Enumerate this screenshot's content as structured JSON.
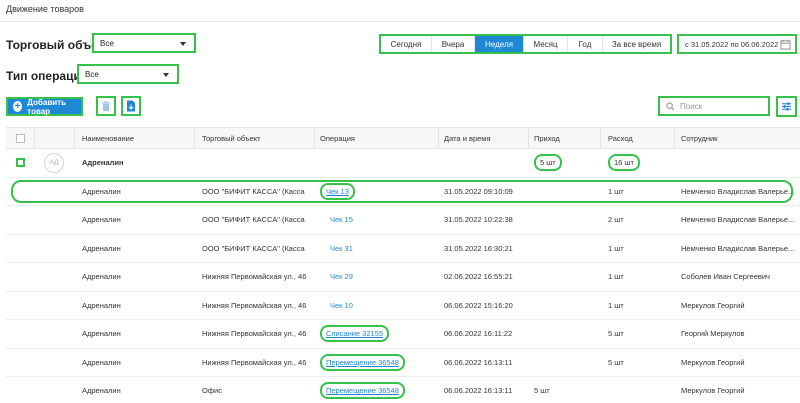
{
  "page": {
    "title": "Движение товаров"
  },
  "filters": {
    "object_label": "Торговый объект",
    "object_value": "Все",
    "operation_label": "Тип операции",
    "operation_value": "Все"
  },
  "periods": [
    {
      "label": "Сегодня",
      "active": false
    },
    {
      "label": "Вчера",
      "active": false
    },
    {
      "label": "Неделя",
      "active": true
    },
    {
      "label": "Месяц",
      "active": false
    },
    {
      "label": "Год",
      "active": false
    },
    {
      "label": "За все время",
      "active": false
    }
  ],
  "date_range": {
    "text": "с 31.05.2022  по 06.06.2022"
  },
  "toolbar": {
    "add_label": "Добавить товар",
    "search_placeholder": "Поиск"
  },
  "table": {
    "columns": [
      "Наименование",
      "Торговый объект",
      "Операция",
      "Дата и время",
      "Приход",
      "Расход",
      "Сотрудник"
    ],
    "group": {
      "avatar": "АД",
      "name": "Адреналин",
      "income": "5 шт",
      "outcome": "16 шт"
    },
    "rows": [
      {
        "name": "Адреналин",
        "object": "ООО \"БИФИТ КАССА\" (Касса П...",
        "operation": "Чек 13",
        "date": "31.05.2022 09:10:09",
        "income": "",
        "outcome": "1 шт",
        "employee": "Немченко Владислав Валерье..."
      },
      {
        "name": "Адреналин",
        "object": "ООО \"БИФИТ КАССА\" (Касса П...",
        "operation": "Чек 15",
        "date": "31.05.2022 10:22:38",
        "income": "",
        "outcome": "2 шт",
        "employee": "Немченко Владислав Валерье..."
      },
      {
        "name": "Адреналин",
        "object": "ООО \"БИФИТ КАССА\" (Касса П...",
        "operation": "Чек 31",
        "date": "31.05.2022 16:30:21",
        "income": "",
        "outcome": "1 шт",
        "employee": "Немченко Владислав Валерье..."
      },
      {
        "name": "Адреналин",
        "object": "Нижняя Первомайская ул., 46",
        "operation": "Чек 29",
        "date": "02.06.2022 16:55:21",
        "income": "",
        "outcome": "1 шт",
        "employee": "Соболев Иван Сергеевич"
      },
      {
        "name": "Адреналин",
        "object": "Нижняя Первомайская ул., 46",
        "operation": "Чек 10",
        "date": "06.06.2022 15:16:20",
        "income": "",
        "outcome": "1 шт",
        "employee": "Меркулов Георгий"
      },
      {
        "name": "Адреналин",
        "object": "Нижняя Первомайская ул., 46",
        "operation": "Списание 32155",
        "date": "06.06.2022 16:11:22",
        "income": "",
        "outcome": "5 шт",
        "employee": "Георгий Меркулов"
      },
      {
        "name": "Адреналин",
        "object": "Нижняя Первомайская ул., 46",
        "operation": "Перемещение 36548",
        "date": "06.06.2022 16:13:11",
        "income": "",
        "outcome": "5 шт",
        "employee": "Меркулов Георгий"
      },
      {
        "name": "Адреналин",
        "object": "Офис",
        "operation": "Перемещение 36548",
        "date": "06.06.2022 16:13:11",
        "income": "5 шт",
        "outcome": "",
        "employee": "Меркулов Георгий"
      }
    ]
  }
}
